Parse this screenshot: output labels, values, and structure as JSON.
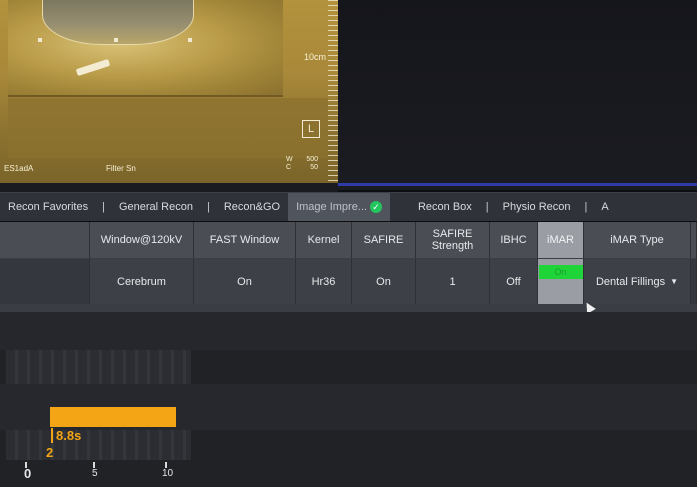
{
  "viewer": {
    "scale_label": "10cm",
    "series_label": "ES1adA",
    "filter_label": "Filter Sn",
    "window_key": "W",
    "window_value": "500",
    "center_key": "C",
    "center_value": "50",
    "tool_icon": "layout-icon"
  },
  "tabs": [
    {
      "label": "Recon Favorites"
    },
    {
      "label": "General Recon"
    },
    {
      "label": "Recon&GO"
    },
    {
      "label": "Image Impre...",
      "active": true
    },
    {
      "label": "Recon Box"
    },
    {
      "label": "Physio Recon"
    },
    {
      "label": "A"
    }
  ],
  "tab_separator": "|",
  "grid": {
    "headers": [
      "Window@120kV",
      "FAST Window",
      "Kernel",
      "SAFIRE",
      "SAFIRE Strength",
      "IBHC",
      "iMAR",
      "iMAR Type"
    ],
    "values": [
      "Cerebrum",
      "On",
      "Hr36",
      "On",
      "1",
      "Off",
      "On",
      "Dental Fillings"
    ],
    "imar_color": "#1fd438"
  },
  "timeline": {
    "scan_time": "8.8s",
    "scan_number": "2",
    "ticks": [
      "0",
      "5",
      "10"
    ],
    "bar_color": "#f3a515"
  }
}
